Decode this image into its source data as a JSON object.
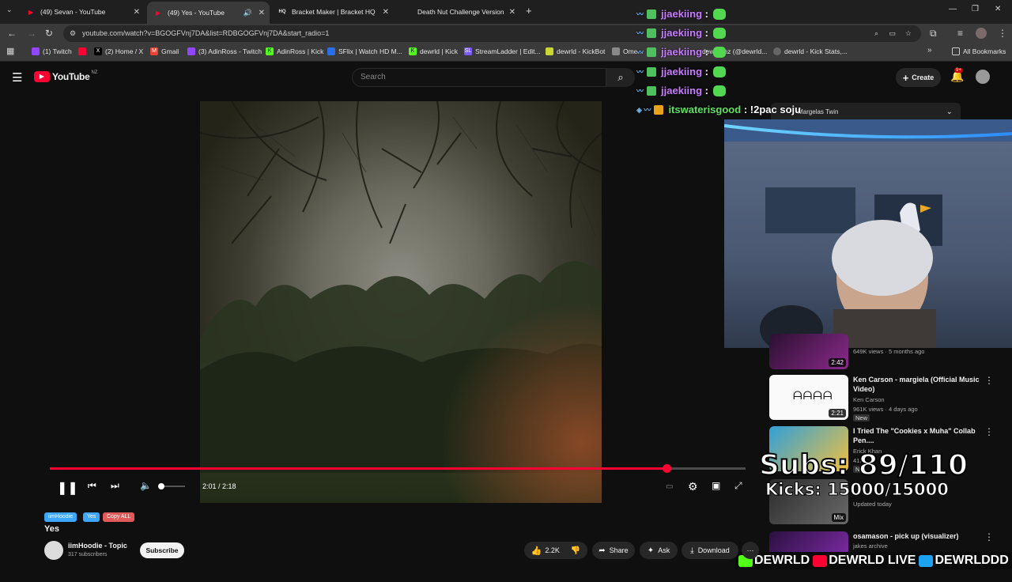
{
  "tabs": [
    {
      "label": "(49) Sevan - YouTube",
      "active": false
    },
    {
      "label": "(49) Yes - YouTube",
      "active": true
    },
    {
      "label": "Bracket Maker | Bracket HQ",
      "active": false
    },
    {
      "label": "Death Nut Challenge Version 2...",
      "active": false
    }
  ],
  "address": {
    "url": "youtube.com/watch?v=BGOGFVnj7DA&list=RDBGOGFVnj7DA&start_radio=1"
  },
  "bookmarks": [
    {
      "label": "(1) Twitch",
      "color": "#9146ff"
    },
    {
      "label": "",
      "color": "#ff0033"
    },
    {
      "label": "(2) Home / X",
      "color": "#000000"
    },
    {
      "label": "Gmail",
      "color": "#ea4335"
    },
    {
      "label": "(3) AdinRoss - Twitch",
      "color": "#9146ff"
    },
    {
      "label": "AdinRoss | Kick",
      "color": "#53fc18"
    },
    {
      "label": "SFlix | Watch HD M...",
      "color": "#2a6ee8"
    },
    {
      "label": "dewrld | Kick",
      "color": "#53fc18"
    },
    {
      "label": "StreamLadder | Edit...",
      "color": "#7a5af8"
    },
    {
      "label": "dewrld - KickBot",
      "color": "#c8d830"
    },
    {
      "label": "Ome...",
      "color": "#888888"
    },
    {
      "label": "dewrld nz (@dewrld...",
      "color": "#000000"
    },
    {
      "label": "dewrld - Kick Stats,...",
      "color": "#666666"
    }
  ],
  "all_bookmarks": "All Bookmarks",
  "youtube": {
    "logo_text": "YouTube",
    "region": "NZ",
    "search_placeholder": "Search",
    "create_label": "Create",
    "notif_count": "9+"
  },
  "player": {
    "time": "2:01 / 2:18",
    "progress": 0.886
  },
  "chat": [
    {
      "user": "jjaekiing",
      "sep": ":",
      "text": "",
      "color": "purple"
    },
    {
      "user": "jjaekiing",
      "sep": ":",
      "text": "",
      "color": "purple"
    },
    {
      "user": "jjaekiing",
      "sep": ":",
      "text": "",
      "color": "purple"
    },
    {
      "user": "jjaekiing",
      "sep": ":",
      "text": "",
      "color": "purple"
    },
    {
      "user": "jjaekiing",
      "sep": ":",
      "text": "",
      "color": "purple"
    },
    {
      "user": "itswaterisgood",
      "sep": ":",
      "text": "!2pac soju",
      "color": "green"
    }
  ],
  "playlist_header": "Margelas Twin",
  "recommendations": [
    {
      "title": "",
      "channel": "",
      "meta": "649K views · 5 months ago",
      "duration": "2:42"
    },
    {
      "title": "Ken Carson - margiela (Official Music Video)",
      "channel": "Ken Carson",
      "meta": "961K views · 4 days ago",
      "badge": "New",
      "duration": "2:21"
    },
    {
      "title": "I Tried The \"Cookies x Muha\" Collab Pen....",
      "channel": "Erick Khan",
      "meta": "41K",
      "badge": "Ne",
      "duration": ""
    },
    {
      "title": "",
      "channel": "",
      "meta": "Updated today",
      "badge": "Mix",
      "duration": ""
    },
    {
      "title": "osamason - pick up (visualizer)",
      "channel": "jakes archive",
      "meta": "",
      "duration": ""
    }
  ],
  "overlay": {
    "subs": "Subs: 89/110",
    "kicks": "Kicks: 15000/15000",
    "social": [
      "DEWRLD",
      "DEWRLD LIVE",
      "DEWRLDDD"
    ]
  },
  "video": {
    "tags": [
      "iimHoodie",
      "Yes",
      "Copy ALL"
    ],
    "tag_colors": [
      "#3ea6ff",
      "#3ea6ff",
      "#e05a5a"
    ],
    "title": "Yes",
    "channel": "iimHoodie - Topic",
    "subscribers": "317 subscribers",
    "subscribe_label": "Subscribe",
    "likes": "2.2K",
    "share_label": "Share",
    "ask_label": "Ask",
    "download_label": "Download"
  }
}
